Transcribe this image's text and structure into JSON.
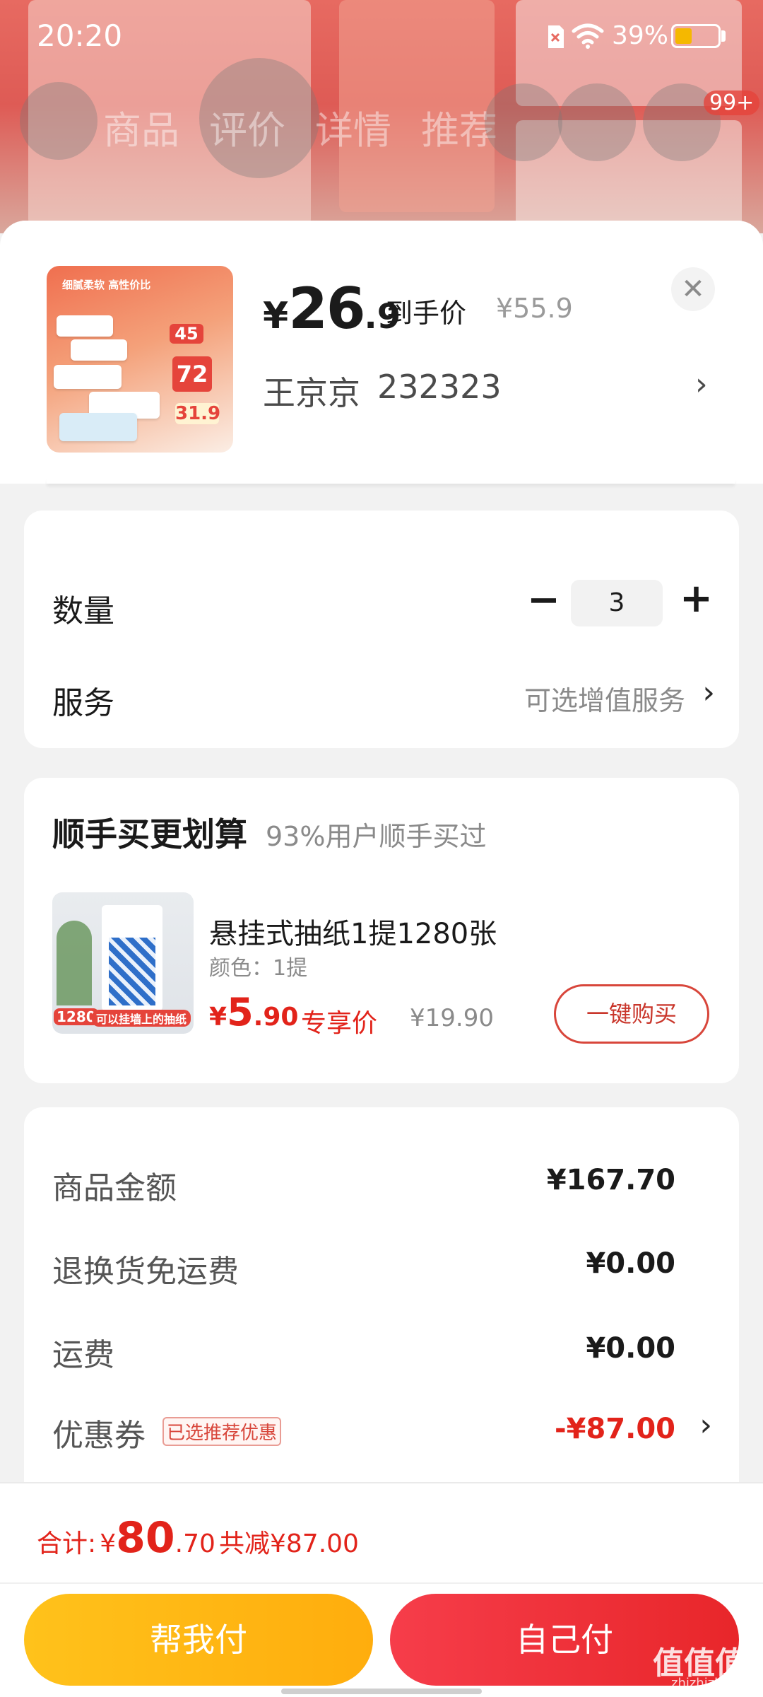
{
  "status_bar": {
    "time": "20:20",
    "battery": "39%",
    "battery_level": 0.39
  },
  "background_page": {
    "nav_tabs": [
      "商品",
      "评价",
      "详情",
      "推荐"
    ],
    "cart_badge": "99+"
  },
  "product": {
    "price_symbol": "¥",
    "price_int": "26",
    "price_dec": ".9",
    "price_label": "到手价",
    "original_price": "¥55.9",
    "recipient_name": "王京京",
    "recipient_phone": "232323",
    "thumb_text": {
      "top": "细腻柔软 高性价比",
      "coupon": "45",
      "deal": "72",
      "final": "31.9"
    }
  },
  "quantity": {
    "label": "数量",
    "value": "3",
    "minus": "−",
    "plus": "+"
  },
  "service": {
    "label": "服务",
    "value": "可选增值服务"
  },
  "addon": {
    "title": "顺手买更划算",
    "subtitle": "93%用户顺手买过",
    "item_name": "悬挂式抽纸1提1280张",
    "item_spec": "颜色：1提",
    "price_symbol": "¥",
    "price_int": "5",
    "price_dec": ".90",
    "price_label": "专享价",
    "original_price": "¥19.90",
    "buy_button": "一键购买",
    "img_badge": "1280",
    "img_caption": "可以挂墙上的抽纸"
  },
  "summary": {
    "rows": [
      {
        "label": "商品金额",
        "value": "¥167.70"
      },
      {
        "label": "退换货免运费",
        "value": "¥0.00"
      },
      {
        "label": "运费",
        "value": "¥0.00"
      }
    ],
    "coupon_label": "优惠券",
    "coupon_tag": "已选推荐优惠",
    "coupon_value": "-¥87.00"
  },
  "total": {
    "label": "合计:",
    "symbol": "¥",
    "int": "80",
    "dec": ".70",
    "saved": "共减¥87.00"
  },
  "buttons": {
    "help_pay": "帮我付",
    "self_pay": "自己付"
  },
  "watermark": {
    "text": "值值值",
    "sub": "zhizhizhi.com"
  },
  "colors": {
    "accent_red": "#e2231a",
    "help_pay_yellow": "#ffb714",
    "self_pay_red": "#f2303a"
  }
}
